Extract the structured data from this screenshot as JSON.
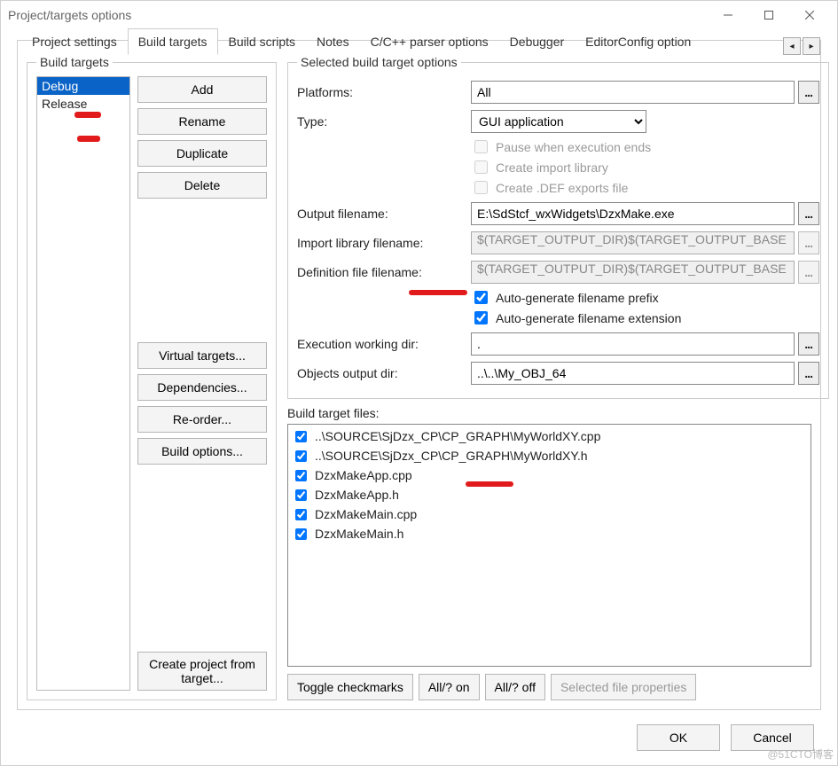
{
  "window": {
    "title": "Project/targets options"
  },
  "tabs": {
    "items": [
      "Project settings",
      "Build targets",
      "Build scripts",
      "Notes",
      "C/C++ parser options",
      "Debugger",
      "EditorConfig option"
    ],
    "active_index": 1
  },
  "build_targets": {
    "legend": "Build targets",
    "items": [
      "Debug",
      "Release"
    ],
    "selected_index": 0,
    "buttons": {
      "add": "Add",
      "rename": "Rename",
      "duplicate": "Duplicate",
      "delete": "Delete",
      "virtual": "Virtual targets...",
      "deps": "Dependencies...",
      "reorder": "Re-order...",
      "build_opts": "Build options...",
      "create_proj": "Create project from target..."
    }
  },
  "selected_options": {
    "legend": "Selected build target options",
    "labels": {
      "platforms": "Platforms:",
      "type": "Type:",
      "output_filename": "Output filename:",
      "import_lib": "Import library filename:",
      "def_file": "Definition file filename:",
      "exec_dir": "Execution working dir:",
      "obj_dir": "Objects output dir:"
    },
    "platforms_value": "All",
    "type_value": "GUI application",
    "type_options": [
      "GUI application"
    ],
    "type_checks": {
      "pause": "Pause when execution ends",
      "pause_checked": false,
      "import": "Create import library",
      "import_checked": false,
      "def": "Create .DEF exports file",
      "def_checked": false
    },
    "output_filename": "E:\\SdStcf_wxWidgets\\DzxMake.exe",
    "import_lib_value": "$(TARGET_OUTPUT_DIR)$(TARGET_OUTPUT_BASE",
    "def_file_value": "$(TARGET_OUTPUT_DIR)$(TARGET_OUTPUT_BASE",
    "auto_prefix": {
      "label": "Auto-generate filename prefix",
      "checked": true
    },
    "auto_ext": {
      "label": "Auto-generate filename extension",
      "checked": true
    },
    "exec_dir_value": ".",
    "obj_dir_value": "..\\..\\My_OBJ_64"
  },
  "target_files": {
    "label": "Build target files:",
    "items": [
      {
        "checked": true,
        "path": "..\\SOURCE\\SjDzx_CP\\CP_GRAPH\\MyWorldXY.cpp"
      },
      {
        "checked": true,
        "path": "..\\SOURCE\\SjDzx_CP\\CP_GRAPH\\MyWorldXY.h"
      },
      {
        "checked": true,
        "path": "DzxMakeApp.cpp"
      },
      {
        "checked": true,
        "path": "DzxMakeApp.h"
      },
      {
        "checked": true,
        "path": "DzxMakeMain.cpp"
      },
      {
        "checked": true,
        "path": "DzxMakeMain.h"
      }
    ],
    "buttons": {
      "toggle": "Toggle checkmarks",
      "all_on": "All/? on",
      "all_off": "All/? off",
      "sel_prop": "Selected file properties"
    }
  },
  "footer": {
    "ok": "OK",
    "cancel": "Cancel"
  },
  "watermark": "@51CTO博客"
}
